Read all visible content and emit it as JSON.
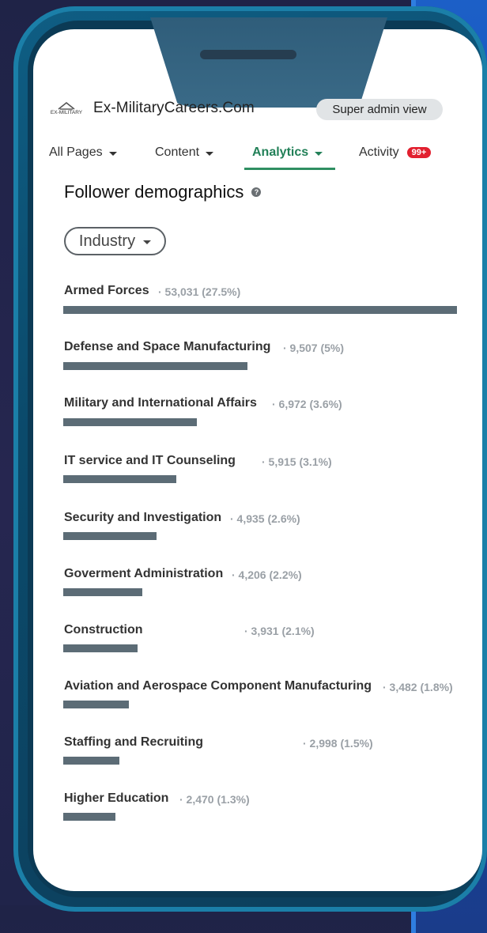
{
  "colors": {
    "accent": "#228058",
    "bar": "#5c6c76",
    "badge": "#e2202f"
  },
  "header": {
    "logo_text": "EX-MILITARY",
    "brand": "Ex-MilitaryCareers.Com",
    "admin_view": "Super admin view"
  },
  "tabs": [
    {
      "label": "All Pages"
    },
    {
      "label": "Content"
    },
    {
      "label": "Analytics"
    },
    {
      "label": "Activity",
      "badge": "99+"
    }
  ],
  "section": {
    "title": "Follower demographics",
    "help_icon": "?"
  },
  "filter": {
    "selected": "Industry"
  },
  "rows": [
    {
      "label": "Armed Forces",
      "value": "· 53,031 (27.5%)",
      "share": 1.0
    },
    {
      "label": "Defense and Space Manufacturing",
      "value": "· 9,507 (5%)",
      "share": 0.468
    },
    {
      "label": "Military and International Affairs",
      "value": "· 6,972 (3.6%)",
      "share": 0.339
    },
    {
      "label": "IT service and IT Counseling",
      "value": "· 5,915 (3.1%)",
      "share": 0.287
    },
    {
      "label": "Security and Investigation",
      "value": "· 4,935 (2.6%)",
      "share": 0.237
    },
    {
      "label": "Goverment Administration",
      "value": "· 4,206 (2.2%)",
      "share": 0.201
    },
    {
      "label": "Construction",
      "value": "· 3,931 (2.1%)",
      "share": 0.189
    },
    {
      "label": "Aviation and Aerospace Component Manufacturing",
      "value": "· 3,482 (1.8%)",
      "share": 0.167
    },
    {
      "label": "Staffing and Recruiting",
      "value": "· 2,998 (1.5%)",
      "share": 0.143
    },
    {
      "label": "Higher Education",
      "value": "· 2,470 (1.3%)",
      "share": 0.133
    }
  ]
}
